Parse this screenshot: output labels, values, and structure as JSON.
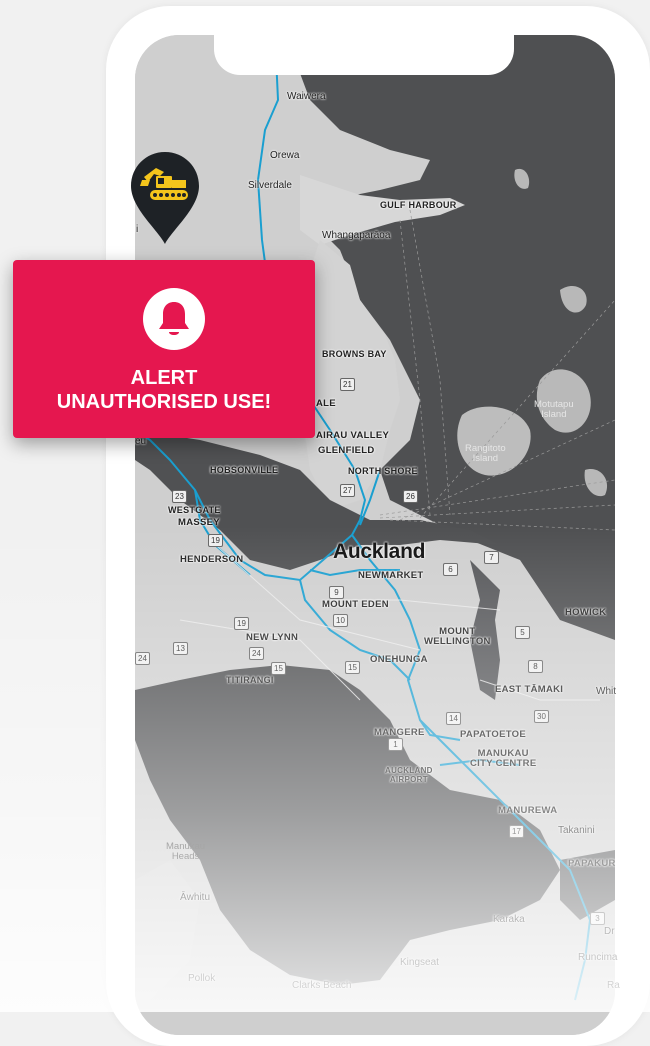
{
  "alert": {
    "title_line1": "ALERT",
    "title_line2": "UNAUTHORISED USE!",
    "icon": "bell-icon",
    "color": "#e5174f"
  },
  "marker": {
    "icon": "excavator-icon",
    "color": "#f4c51c"
  },
  "map": {
    "city": "Auckland",
    "places": {
      "waiwera": "Waiwera",
      "orewa": "Orewa",
      "silverdale": "Silverdale",
      "gulf_harbour": "GULF HARBOUR",
      "whangaparaoa": "Whangaparāoa",
      "browns_bay": "BROWNS BAY",
      "ale": "ALE",
      "airau_valley": "AIRAU VALLEY",
      "glenfield": "GLENFIELD",
      "north_shore": "NORTH SHORE",
      "hobsonville": "HOBSONVILLE",
      "westgate": "WESTGATE",
      "massey": "MASSEY",
      "newmarket": "NEWMARKET",
      "henderson": "HENDERSON",
      "mount_eden": "MOUNT EDEN",
      "howick": "HOWICK",
      "mount_wellington": "MOUNT\nWELLINGTON",
      "new_lynn": "NEW LYNN",
      "onehunga": "ONEHUNGA",
      "titirangi": "TITIRANGI",
      "east_tamaki": "EAST TĀMAKI",
      "whit": "Whit",
      "mangere": "MANGERE",
      "papatoetoe": "PAPATOETOE",
      "manukau": "MANUKAU\nCITY CENTRE",
      "airport": "AUCKLAND\nAIRPORT",
      "manurewa": "MANUREWA",
      "takanini": "Takanini",
      "papakura": "PAPAKUR",
      "manukau_heads": "Manukau\nHeads",
      "awhitu": "Āwhitu",
      "karaka": "Karaka",
      "dr": "Dr",
      "runciman": "Runcima",
      "kingseat": "Kingseat",
      "pollok": "Pollok",
      "clarks_beach": "Clarks Beach",
      "ra": "Ra",
      "motutapu": "Motutapu\nIsland",
      "rangitoto": "Rangitoto\nIsland",
      "eu": "eu",
      "i": "i"
    },
    "routes": [
      "21",
      "23",
      "27",
      "26",
      "19",
      "9",
      "7",
      "6",
      "10",
      "19",
      "13",
      "24",
      "24",
      "15",
      "15",
      "5",
      "8",
      "14",
      "30",
      "17",
      "3",
      "1"
    ]
  }
}
